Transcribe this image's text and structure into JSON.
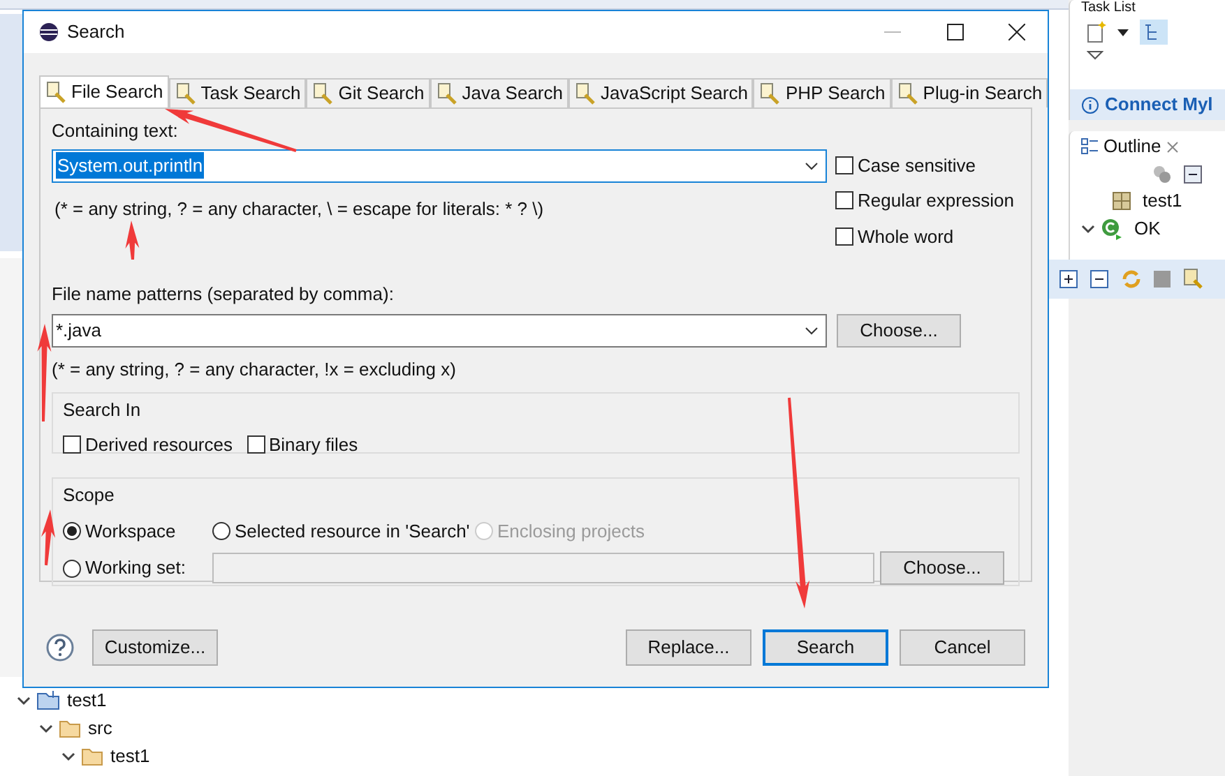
{
  "background": {
    "task_list": {
      "title": "Task List",
      "link": "Connect Myl"
    },
    "outline": {
      "title": "Outline",
      "items": [
        {
          "label": "test1",
          "kind": "package"
        },
        {
          "label": "OK",
          "kind": "class"
        }
      ]
    },
    "tree": [
      {
        "label": "test1",
        "kind": "project",
        "expanded": true,
        "children": [
          {
            "label": "src",
            "kind": "folder",
            "expanded": true,
            "children": [
              {
                "label": "test1",
                "kind": "folder",
                "expanded": true
              }
            ]
          }
        ]
      }
    ]
  },
  "dialog": {
    "title": "Search",
    "tabs": [
      {
        "label": "File Search",
        "selected": true
      },
      {
        "label": "Task Search",
        "selected": false
      },
      {
        "label": "Git Search",
        "selected": false
      },
      {
        "label": "Java Search",
        "selected": false
      },
      {
        "label": "JavaScript Search",
        "selected": false
      },
      {
        "label": "PHP Search",
        "selected": false
      },
      {
        "label": "Plug-in Search",
        "selected": false
      }
    ],
    "containing_text": {
      "label": "Containing text:",
      "value": "System.out.println",
      "hint": "(* = any string, ? = any character, \\ = escape for literals: * ? \\)"
    },
    "options": [
      {
        "label": "Case sensitive",
        "checked": false
      },
      {
        "label": "Regular expression",
        "checked": false
      },
      {
        "label": "Whole word",
        "checked": false
      }
    ],
    "file_patterns": {
      "label": "File name patterns (separated by comma):",
      "value": "*.java",
      "hint": "(* = any string, ? = any character, !x = excluding x)",
      "button": "Choose..."
    },
    "search_in": {
      "title": "Search In",
      "options": [
        {
          "label": "Derived resources",
          "checked": false
        },
        {
          "label": "Binary files",
          "checked": false
        }
      ]
    },
    "scope": {
      "title": "Scope",
      "options": [
        {
          "label": "Workspace",
          "selected": true,
          "disabled": false
        },
        {
          "label": "Selected resource in 'Search'",
          "selected": false,
          "disabled": false
        },
        {
          "label": "Enclosing projects",
          "selected": false,
          "disabled": true
        }
      ],
      "working_set": {
        "label": "Working set:",
        "selected": false,
        "button": "Choose..."
      }
    },
    "buttons": [
      {
        "label": "Customize...",
        "kind": "left",
        "default": false
      },
      {
        "label": "Replace...",
        "kind": "right",
        "default": false
      },
      {
        "label": "Search",
        "kind": "right",
        "default": true
      },
      {
        "label": "Cancel",
        "kind": "right",
        "default": false
      }
    ]
  }
}
